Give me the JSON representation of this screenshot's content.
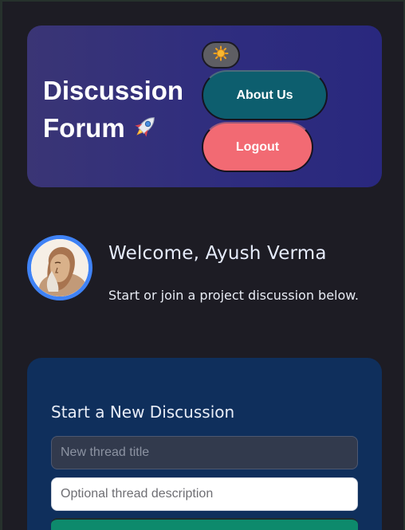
{
  "header": {
    "title_line1": "Discussion",
    "title_line2": "Forum",
    "rocket_icon": "rocket-icon",
    "theme_toggle_icon": "sun-icon",
    "about_label": "About Us",
    "logout_label": "Logout",
    "colors": {
      "card": "#2f2d7f",
      "about_button": "#0d5e6e",
      "logout_button": "#f26a73"
    }
  },
  "welcome": {
    "heading": "Welcome, Ayush Verma",
    "subtitle": "Start or join a project discussion below.",
    "avatar_icon": "user-avatar",
    "avatar_ring_color": "#3f82f5"
  },
  "new_discussion": {
    "heading": "Start a New Discussion",
    "title_placeholder": "New thread title",
    "title_value": "",
    "description_placeholder": "Optional thread description",
    "description_value": "",
    "submit_color": "#0d8a6c"
  }
}
